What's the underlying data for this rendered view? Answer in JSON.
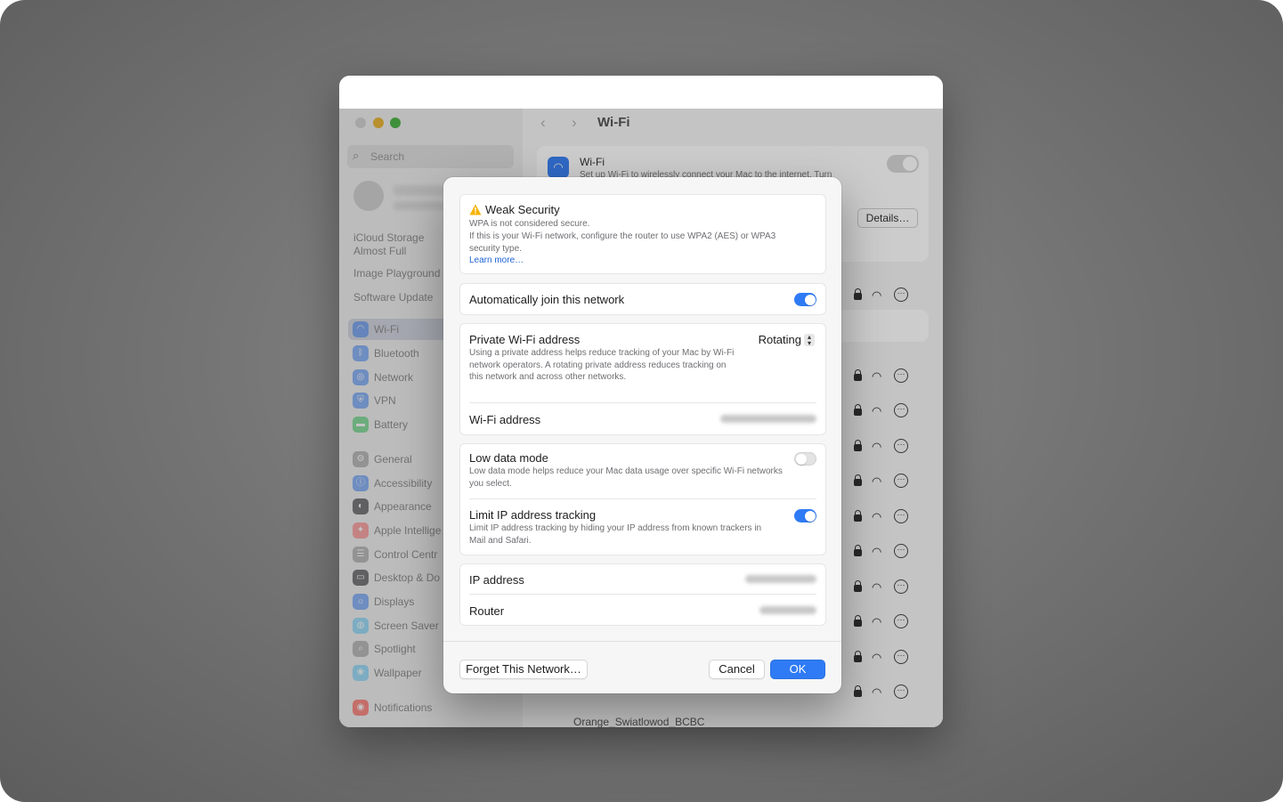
{
  "window": {
    "title": "Wi-Fi"
  },
  "sidebar": {
    "search_placeholder": "Search",
    "notes": [
      "iCloud Storage",
      "Almost Full",
      "Image Playground",
      "Software Update"
    ],
    "items": [
      {
        "label": "Wi-Fi",
        "icon": "wifi-icon",
        "color": "#3b82f6"
      },
      {
        "label": "Bluetooth",
        "icon": "bluetooth-icon",
        "color": "#3b82f6"
      },
      {
        "label": "Network",
        "icon": "globe-icon",
        "color": "#3b82f6"
      },
      {
        "label": "VPN",
        "icon": "vpn-icon",
        "color": "#3b82f6"
      },
      {
        "label": "Battery",
        "icon": "battery-icon",
        "color": "#34c759"
      },
      {
        "label": "General",
        "icon": "gear-icon",
        "color": "#8e8e93"
      },
      {
        "label": "Accessibility",
        "icon": "accessibility-icon",
        "color": "#3b82f6"
      },
      {
        "label": "Appearance",
        "icon": "appearance-icon",
        "color": "#1d1d1f"
      },
      {
        "label": "Apple Intellige",
        "icon": "apple-intelligence-icon",
        "color": "#ff6b6b"
      },
      {
        "label": "Control Centr",
        "icon": "control-centre-icon",
        "color": "#8e8e93"
      },
      {
        "label": "Desktop & Do",
        "icon": "desktop-dock-icon",
        "color": "#1d1d1f"
      },
      {
        "label": "Displays",
        "icon": "displays-icon",
        "color": "#3b82f6"
      },
      {
        "label": "Screen Saver",
        "icon": "screen-saver-icon",
        "color": "#5ac8fa"
      },
      {
        "label": "Spotlight",
        "icon": "spotlight-icon",
        "color": "#8e8e93"
      },
      {
        "label": "Wallpaper",
        "icon": "wallpaper-icon",
        "color": "#5ac8fa"
      },
      {
        "label": "Notifications",
        "icon": "notifications-icon",
        "color": "#ff3b30"
      }
    ]
  },
  "content": {
    "wifi_label": "Wi-Fi",
    "wifi_desc": "Set up Wi-Fi to wirelessly connect your Mac to the internet. Turn",
    "details_button": "Details…",
    "visible_network": "Orange_Swiatlowod_BCBC"
  },
  "dialog": {
    "warning": {
      "title": "Weak Security",
      "subtitle": "WPA is not considered secure.",
      "body": "If this is your Wi-Fi network, configure the router to use WPA2 (AES) or WPA3 security type.",
      "link": "Learn more…",
      "color": "#f5b301"
    },
    "auto_join": {
      "label": "Automatically join this network",
      "enabled": true
    },
    "private_address": {
      "label": "Private Wi-Fi address",
      "value": "Rotating",
      "desc": "Using a private address helps reduce tracking of your Mac by Wi-Fi network operators. A rotating private address reduces tracking on this network and across other networks."
    },
    "wifi_address": {
      "label": "Wi-Fi address"
    },
    "low_data": {
      "label": "Low data mode",
      "desc": "Low data mode helps reduce your Mac data usage over specific Wi-Fi networks you select.",
      "enabled": false
    },
    "limit_ip": {
      "label": "Limit IP address tracking",
      "desc": "Limit IP address tracking by hiding your IP address from known trackers in Mail and Safari.",
      "enabled": true
    },
    "ip_address": {
      "label": "IP address"
    },
    "router": {
      "label": "Router"
    },
    "buttons": {
      "forget": "Forget This Network…",
      "cancel": "Cancel",
      "ok": "OK"
    },
    "accent": "#2f7bf5"
  }
}
